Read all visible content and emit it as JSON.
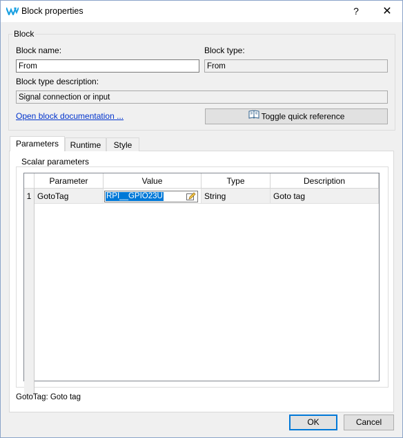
{
  "window": {
    "title": "Block properties",
    "help": "?",
    "close": "✕"
  },
  "block": {
    "group_title": "Block",
    "name_label": "Block name:",
    "name_value": "From",
    "type_label": "Block type:",
    "type_value": "From",
    "desc_label": "Block type description:",
    "desc_value": "Signal connection or input",
    "doc_link": "Open block documentation ...",
    "toggle_label": "Toggle quick reference"
  },
  "tabs": [
    {
      "label": "Parameters",
      "active": true
    },
    {
      "label": "Runtime",
      "active": false
    },
    {
      "label": "Style",
      "active": false
    }
  ],
  "scalar": {
    "group_title": "Scalar parameters",
    "columns": [
      "Parameter",
      "Value",
      "Type",
      "Description"
    ],
    "rows": [
      {
        "index": "1",
        "parameter": "GotoTag",
        "value": "RPI__GPIO23U",
        "type": "String",
        "description": "Goto tag"
      }
    ]
  },
  "status_text": "GotoTag: Goto tag",
  "footer": {
    "ok": "OK",
    "cancel": "Cancel"
  },
  "colors": {
    "accent": "#0078d7",
    "link": "#0033cc",
    "logo": "#1ba1e2"
  }
}
